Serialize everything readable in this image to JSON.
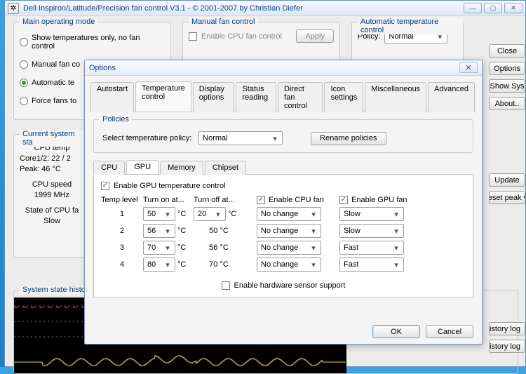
{
  "window": {
    "title": "Dell Inspiron/Latitude/Precision fan control V3.1 - © 2001-2007 by Christian Diefer",
    "icon_glyph": "✲"
  },
  "right_buttons": [
    "Close",
    "Options",
    "Show Sys",
    "About.."
  ],
  "main_mode_group": {
    "legend": "Main operating mode",
    "options": [
      {
        "label": "Show temperatures only, no fan control",
        "checked": false
      },
      {
        "label": "Manual fan co",
        "checked": false
      },
      {
        "label": "Automatic te",
        "checked": true
      },
      {
        "label": "Force fans to",
        "checked": false
      }
    ]
  },
  "manual_group": {
    "legend": "Manual fan control",
    "checkbox_label": "Enable CPU fan control",
    "apply": "Apply"
  },
  "auto_group": {
    "legend": "Automatic temperature control",
    "policy_label": "Policy:",
    "policy_value": "Normal"
  },
  "state_group": {
    "legend": "Current system sta",
    "cpu_temp_label": "CPU temp",
    "core_line": "Core1/2: 22 / 2",
    "peak_line": "Peak: 46 °C",
    "cpu_speed_label": "CPU speed",
    "cpu_speed_value": "1999 MHz",
    "state_fan_label": "State of CPU fa",
    "state_fan_value": "Slow",
    "update": "Update",
    "reset": "Reset peak va"
  },
  "history_legend": "System state histor",
  "history_log_btn": "history log",
  "options_dialog": {
    "title": "Options",
    "tabs": [
      "Autostart",
      "Temperature control",
      "Display options",
      "Status reading",
      "Direct fan control",
      "Icon settings",
      "Miscellaneous",
      "Advanced"
    ],
    "active_tab": 1,
    "policies_legend": "Policies",
    "policy_row_label": "Select temperature policy:",
    "policy_value": "Normal",
    "rename_btn": "Rename policies",
    "subtabs": [
      "CPU",
      "GPU",
      "Memory",
      "Chipset"
    ],
    "active_subtab": 1,
    "enable_gpu_label": "Enable GPU temperature control",
    "enable_gpu_checked": true,
    "cols": {
      "level": "Temp level",
      "on": "Turn on at...",
      "off": "Turn off at..."
    },
    "enable_cpu_fan_label": "Enable CPU fan",
    "enable_gpu_fan_label": "Enable GPU fan",
    "enable_cpu_fan_checked": true,
    "enable_gpu_fan_checked": true,
    "rows": [
      {
        "level": "1",
        "on": "50",
        "off": "20",
        "off_is_select": true,
        "cpu": "No change",
        "gpu": "Slow"
      },
      {
        "level": "2",
        "on": "56",
        "off": "50 °C",
        "off_is_select": false,
        "cpu": "No change",
        "gpu": "Slow"
      },
      {
        "level": "3",
        "on": "70",
        "off": "56 °C",
        "off_is_select": false,
        "cpu": "No change",
        "gpu": "Fast"
      },
      {
        "level": "4",
        "on": "80",
        "off": "70 °C",
        "off_is_select": false,
        "cpu": "No change",
        "gpu": "Fast"
      }
    ],
    "deg": "°C",
    "hw_sensor_label": "Enable hardware sensor support",
    "hw_sensor_checked": false,
    "ok": "OK",
    "cancel": "Cancel"
  }
}
